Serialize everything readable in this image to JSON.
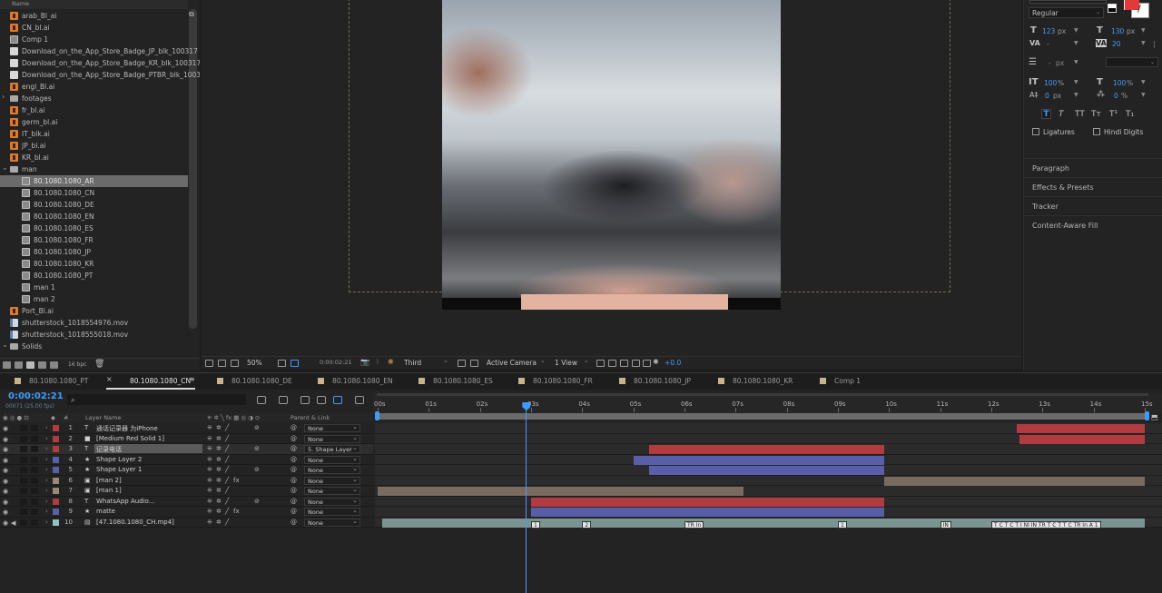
{
  "project": {
    "name_header": "Name",
    "items": [
      {
        "label": "arab_Bl_ai",
        "type": "ai"
      },
      {
        "label": "CN_bl.ai",
        "type": "ai"
      },
      {
        "label": "Comp 1",
        "type": "comp"
      },
      {
        "label": "Download_on_the_App_Store_Badge_JP_blk_100317",
        "type": "doc"
      },
      {
        "label": "Download_on_the_App_Store_Badge_KR_blk_100317",
        "type": "doc"
      },
      {
        "label": "Download_on_the_App_Store_Badge_PTBR_blk_1003",
        "type": "doc"
      },
      {
        "label": "engl_Bl.ai",
        "type": "ai"
      },
      {
        "label": "footages",
        "type": "folder"
      },
      {
        "label": "fr_bl.ai",
        "type": "ai"
      },
      {
        "label": "germ_bl.ai",
        "type": "ai"
      },
      {
        "label": "IT_blk.ai",
        "type": "ai"
      },
      {
        "label": "JP_bl.ai",
        "type": "ai"
      },
      {
        "label": "KR_bl.ai",
        "type": "ai"
      },
      {
        "label": "man",
        "type": "folder"
      },
      {
        "label": "80.1080.1080_AR",
        "type": "comp",
        "selected": true
      },
      {
        "label": "80.1080.1080_CN",
        "type": "comp"
      },
      {
        "label": "80.1080.1080_DE",
        "type": "comp"
      },
      {
        "label": "80.1080.1080_EN",
        "type": "comp"
      },
      {
        "label": "80.1080.1080_ES",
        "type": "comp"
      },
      {
        "label": "80.1080.1080_FR",
        "type": "comp"
      },
      {
        "label": "80.1080.1080_JP",
        "type": "comp"
      },
      {
        "label": "80.1080.1080_KR",
        "type": "comp"
      },
      {
        "label": "80.1080.1080_PT",
        "type": "comp"
      },
      {
        "label": "man 1",
        "type": "comp"
      },
      {
        "label": "man 2",
        "type": "comp"
      },
      {
        "label": "Port_Bl.ai",
        "type": "ai"
      },
      {
        "label": "shutterstock_1018554976.mov",
        "type": "mov"
      },
      {
        "label": "shutterstock_1018555018.mov",
        "type": "mov"
      },
      {
        "label": "Solids",
        "type": "folder"
      }
    ],
    "bpc": "16 bpc"
  },
  "viewer": {
    "zoom": "50%",
    "timecode": "0:00:02:21",
    "resolution": "Third",
    "camera": "Active Camera",
    "views": "1 View",
    "exposure": "+0.0"
  },
  "character": {
    "style": "Regular",
    "font_size": "123",
    "leading": "130",
    "unit_px": "px",
    "kerning": "-",
    "tracking": "20",
    "stroke": "-",
    "v_scale": "100",
    "h_scale": "100",
    "percent": "%",
    "baseline": "0",
    "tsume": "0",
    "ligatures": "Ligatures",
    "hindi_digits": "Hindi Digits",
    "fill_color": "#e23a3a"
  },
  "panels": [
    "Paragraph",
    "Effects & Presets",
    "Tracker",
    "Content-Aware Fill"
  ],
  "tabs": [
    {
      "label": "80.1080.1080_PT",
      "active": false
    },
    {
      "label": "80.1080.1080_CN",
      "active": true
    },
    {
      "label": "80.1080.1080_DE",
      "active": false
    },
    {
      "label": "80.1080.1080_EN",
      "active": false
    },
    {
      "label": "80.1080.1080_ES",
      "active": false
    },
    {
      "label": "80.1080.1080_FR",
      "active": false
    },
    {
      "label": "80.1080.1080_JP",
      "active": false
    },
    {
      "label": "80.1080.1080_KR",
      "active": false
    },
    {
      "label": "Comp 1",
      "active": false
    }
  ],
  "timeline": {
    "timecode": "0:00:02:21",
    "fps": "00071 (25.00 fps)",
    "col_layer_name": "Layer Name",
    "col_parent": "Parent & Link",
    "col_hash": "#",
    "ruler": [
      "00s",
      "01s",
      "02s",
      "03s",
      "04s",
      "05s",
      "06s",
      "07s",
      "08s",
      "09s",
      "10s",
      "11s",
      "12s",
      "13s",
      "14s",
      "15s"
    ],
    "current_time_s": 2.9,
    "duration_s": 15,
    "layers": [
      {
        "num": "1",
        "type": "T",
        "name": "通话记录器 为iPhone",
        "label_color": "#b23b40",
        "parent": "None",
        "bars": [
          {
            "start": 12.5,
            "end": 15,
            "color": "red"
          }
        ]
      },
      {
        "num": "2",
        "type": "■",
        "name": "[Medium Red Solid 1]",
        "label_color": "#b23b40",
        "parent": "None",
        "bars": [
          {
            "start": 12.55,
            "end": 15,
            "color": "red"
          }
        ]
      },
      {
        "num": "3",
        "type": "T",
        "name": "记录电话",
        "label_color": "#b23b40",
        "parent": "5. Shape Layer",
        "selected": true,
        "bars": [
          {
            "start": 5.3,
            "end": 9.9,
            "color": "red"
          }
        ]
      },
      {
        "num": "4",
        "type": "★",
        "name": "Shape Layer 2",
        "label_color": "#595ea8",
        "parent": "None",
        "bars": [
          {
            "start": 5.0,
            "end": 9.9,
            "color": "blue"
          }
        ]
      },
      {
        "num": "5",
        "type": "★",
        "name": "Shape Layer 1",
        "label_color": "#595ea8",
        "parent": "None",
        "bars": [
          {
            "start": 5.3,
            "end": 9.9,
            "color": "blue"
          }
        ]
      },
      {
        "num": "6",
        "type": "▣",
        "name": "[man 2]",
        "label_color": "#9b8a70",
        "parent": "None",
        "bars": [
          {
            "start": 9.9,
            "end": 15,
            "color": "tan"
          }
        ]
      },
      {
        "num": "7",
        "type": "▣",
        "name": "[man 1]",
        "label_color": "#9b8a70",
        "parent": "None",
        "bars": [
          {
            "start": 0,
            "end": 7.15,
            "color": "tan"
          }
        ]
      },
      {
        "num": "8",
        "type": "T",
        "name": "WhatsApp Audio...",
        "label_color": "#b23b40",
        "parent": "None",
        "bars": [
          {
            "start": 3.0,
            "end": 9.9,
            "color": "red"
          }
        ]
      },
      {
        "num": "9",
        "type": "★",
        "name": "matte",
        "label_color": "#595ea8",
        "parent": "None",
        "bars": [
          {
            "start": 3.0,
            "end": 9.9,
            "color": "blue"
          }
        ]
      },
      {
        "num": "10",
        "type": "▤",
        "name": "[47.1080.1080_CH.mp4]",
        "label_color": "#8fc3c0",
        "parent": "None",
        "bars": [
          {
            "start": 0.08,
            "end": 15,
            "color": "teal"
          }
        ]
      }
    ],
    "markers": [
      {
        "t": 3.0,
        "label": "1"
      },
      {
        "t": 4.0,
        "label": "2"
      },
      {
        "t": 6.0,
        "label": "TR In"
      },
      {
        "t": 9.0,
        "label": "1"
      },
      {
        "t": 11.0,
        "label": "IN"
      },
      {
        "t": 12.0,
        "label": "T C T C T I NI IN TR T C T T C TR In A 1"
      }
    ]
  }
}
